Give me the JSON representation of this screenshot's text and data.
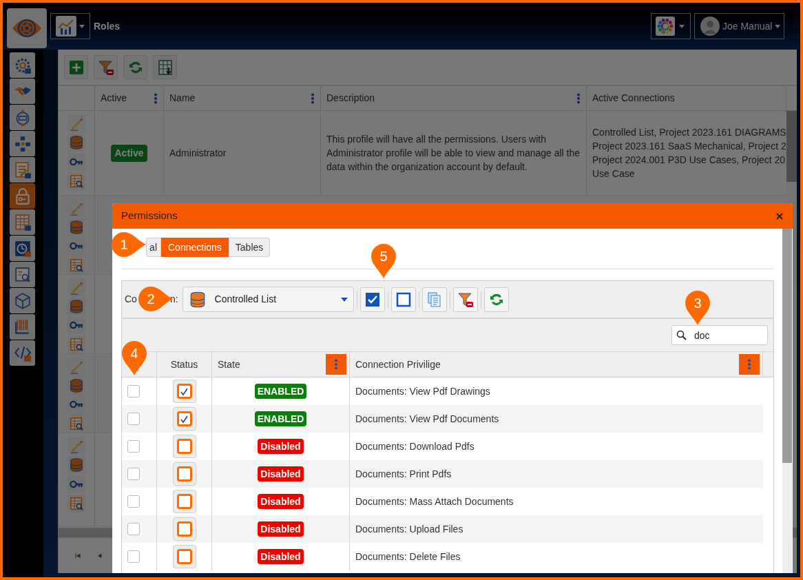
{
  "header": {
    "title": "Roles",
    "user": "Joe Manual"
  },
  "sidebar": {
    "items": [
      {
        "kind": "settings",
        "selected": false
      },
      {
        "kind": "handshake",
        "selected": false
      },
      {
        "kind": "work-order",
        "selected": false
      },
      {
        "kind": "hierarchy",
        "selected": false
      },
      {
        "kind": "form",
        "selected": false
      },
      {
        "kind": "lock",
        "selected": true
      },
      {
        "kind": "table",
        "selected": false
      },
      {
        "kind": "history",
        "selected": false
      },
      {
        "kind": "report",
        "selected": false
      },
      {
        "kind": "cube",
        "selected": false
      },
      {
        "kind": "barcode",
        "selected": false
      },
      {
        "kind": "code",
        "selected": false
      }
    ]
  },
  "toolbar": [
    {
      "kind": "add"
    },
    {
      "kind": "clear-filter"
    },
    {
      "kind": "refresh"
    },
    {
      "kind": "export"
    }
  ],
  "roles_table": {
    "columns": [
      {
        "label": "Active",
        "menu": true
      },
      {
        "label": "Name",
        "menu": true
      },
      {
        "label": "Description",
        "menu": true
      },
      {
        "label": "Active Connections",
        "menu": false
      }
    ],
    "rows": [
      {
        "kind": "full",
        "active": "Active",
        "name": "Administrator",
        "description": "This profile will have all the permissions. Users with Administrator profile will be able to view and manage all the data within the organization account by default.",
        "connections": [
          "Controlled List, Project 2023.161 DIAGRAMS",
          "Project 2023.161 SaaS Mechanical, Project 2",
          "Project 2024.001 P3D Use Cases, Project 20",
          "Use Case"
        ]
      },
      {
        "kind": "covered"
      },
      {
        "kind": "covered"
      },
      {
        "kind": "covered"
      },
      {
        "kind": "covered"
      }
    ]
  },
  "pager": [
    {
      "kind": "first"
    },
    {
      "kind": "prev"
    }
  ],
  "modal": {
    "title": "Permissions",
    "tabs": [
      {
        "label": "al",
        "selected": false
      },
      {
        "label": "Connections",
        "selected": true
      },
      {
        "label": "Tables",
        "selected": false
      }
    ],
    "connection_label": [
      "Co",
      "n:"
    ],
    "connection": "Controlled List",
    "tools": [
      {
        "kind": "check-all"
      },
      {
        "kind": "uncheck-all"
      },
      {
        "kind": "copy"
      },
      {
        "kind": "clear-filter"
      },
      {
        "kind": "refresh"
      }
    ],
    "search": {
      "value": "doc"
    },
    "columns": [
      {
        "label": "Status",
        "menu": false
      },
      {
        "label": "State",
        "menu": true
      },
      {
        "label": "Connection Privilige",
        "menu": true
      }
    ],
    "rows": [
      {
        "selected": false,
        "checked": true,
        "enabled": true,
        "state": "ENABLED",
        "privilege": "Documents: View Pdf Drawings"
      },
      {
        "selected": false,
        "checked": true,
        "enabled": true,
        "state": "ENABLED",
        "privilege": "Documents: View Pdf Documents"
      },
      {
        "selected": false,
        "checked": false,
        "enabled": false,
        "state": "Disabled",
        "privilege": "Documents: Download Pdfs"
      },
      {
        "selected": false,
        "checked": false,
        "enabled": false,
        "state": "Disabled",
        "privilege": "Documents: Print Pdfs"
      },
      {
        "selected": false,
        "checked": false,
        "enabled": false,
        "state": "Disabled",
        "privilege": "Documents: Mass Attach Documents"
      },
      {
        "selected": false,
        "checked": false,
        "enabled": false,
        "state": "Disabled",
        "privilege": "Documents: Upload Files"
      },
      {
        "selected": false,
        "checked": false,
        "enabled": false,
        "state": "Disabled",
        "privilege": "Documents: Delete Files"
      }
    ]
  },
  "callouts": [
    {
      "number": "1",
      "kind": "right"
    },
    {
      "number": "2",
      "kind": "right"
    },
    {
      "number": "3",
      "kind": "down"
    },
    {
      "number": "4",
      "kind": "down"
    },
    {
      "number": "5",
      "kind": "down"
    }
  ]
}
